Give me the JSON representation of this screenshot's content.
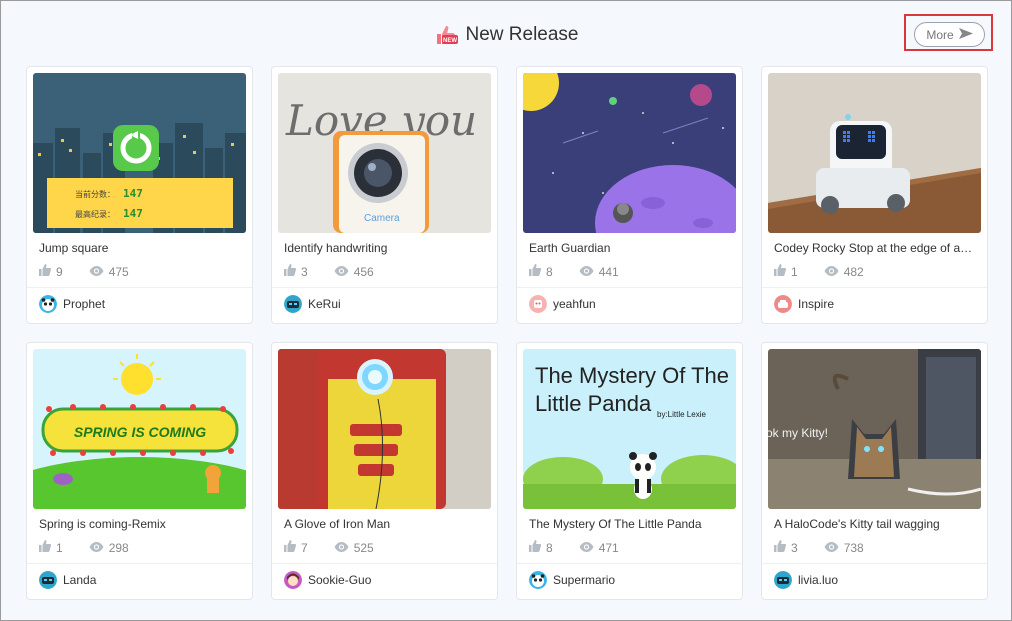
{
  "header": {
    "title": "New Release",
    "icon": "new-thumbs-up-icon",
    "more_label": "More"
  },
  "cards": [
    {
      "title": "Jump square",
      "likes": "9",
      "views": "475",
      "author": "Prophet",
      "avatar": "panda-avatar"
    },
    {
      "title": "Identify handwriting",
      "likes": "3",
      "views": "456",
      "author": "KeRui",
      "avatar": "robot-avatar"
    },
    {
      "title": "Earth Guardian",
      "likes": "8",
      "views": "441",
      "author": "yeahfun",
      "avatar": "sticker-avatar"
    },
    {
      "title": "Codey Rocky Stop at the edge of a…",
      "likes": "1",
      "views": "482",
      "author": "Inspire",
      "avatar": "drone-avatar"
    },
    {
      "title": "Spring is coming-Remix",
      "likes": "1",
      "views": "298",
      "author": "Landa",
      "avatar": "robot-avatar"
    },
    {
      "title": "A Glove of Iron Man",
      "likes": "7",
      "views": "525",
      "author": "Sookie-Guo",
      "avatar": "girl-avatar"
    },
    {
      "title": "The Mystery Of The Little Panda",
      "likes": "8",
      "views": "471",
      "author": "Supermario",
      "avatar": "panda-avatar"
    },
    {
      "title": "A HaloCode's Kitty tail wagging",
      "likes": "3",
      "views": "738",
      "author": "livia.luo",
      "avatar": "robot-avatar"
    }
  ],
  "thumb_text": {
    "jump_score_label": "当前分数：",
    "jump_score": "147",
    "jump_best_label": "最高纪录：",
    "jump_best": "147",
    "love_you": "Love you",
    "camera": "Camera",
    "spring": "SPRING IS COMING",
    "panda_title_1": "The Mystery Of The",
    "panda_title_2": "Little Panda",
    "panda_by": "by:Little Lexie",
    "kitty": "ok my Kitty!"
  },
  "colors": {
    "accent": "#d9373a",
    "card_border": "#e3e7ec",
    "muted": "#888888"
  }
}
